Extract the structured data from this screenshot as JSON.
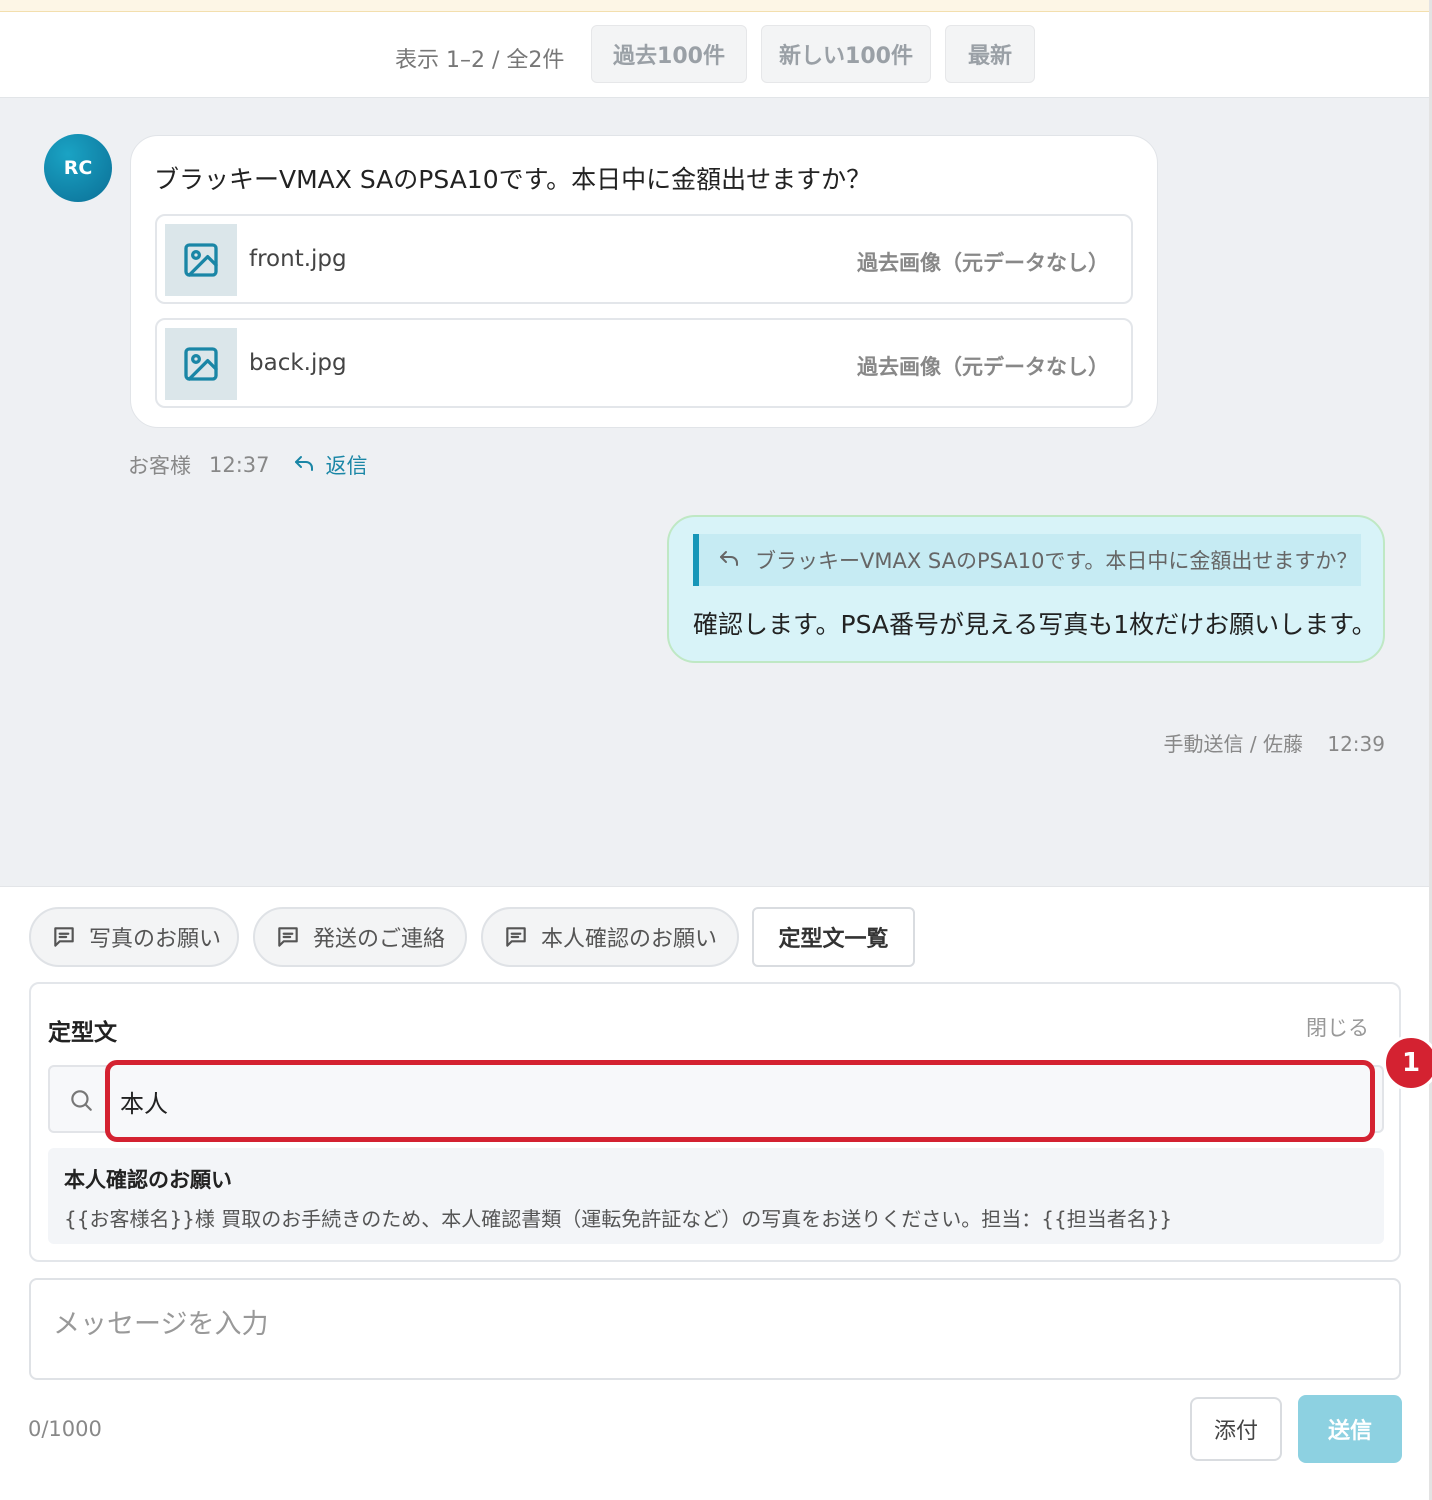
{
  "pager": {
    "info": "表示 1–2 / 全2件",
    "prev_label": "過去100件",
    "next_label": "新しい100件",
    "latest_label": "最新"
  },
  "messages": {
    "incoming": {
      "avatar_initials": "RC",
      "text": "ブラッキーVMAX SAのPSA10です。本日中に金額出せますか？",
      "attachments": [
        {
          "name": "front.jpg",
          "note": "過去画像（元データなし）",
          "icon": "image-icon"
        },
        {
          "name": "back.jpg",
          "note": "過去画像（元データなし）",
          "icon": "image-icon"
        }
      ],
      "sender": "お客様",
      "time": "12:37",
      "reply_label": "返信"
    },
    "outgoing": {
      "quote": "ブラッキーVMAX SAのPSA10です。本日中に金額出せますか？",
      "text": "確認します。PSA番号が見える写真も1枚だけお願いします。",
      "sender": "手動送信 / 佐藤",
      "time": "12:39"
    }
  },
  "composer": {
    "chips": [
      {
        "label": "写真のお願い",
        "icon": "message-icon"
      },
      {
        "label": "発送のご連絡",
        "icon": "message-icon"
      },
      {
        "label": "本人確認のお願い",
        "icon": "message-icon"
      }
    ],
    "template_list_label": "定型文一覧",
    "template_panel": {
      "title": "定型文",
      "close_label": "閉じる",
      "search_value": "本人",
      "badge": "1",
      "results": [
        {
          "title": "本人確認のお願い",
          "body": "{{お客様名}}様 買取のお手続きのため、本人確認書類（運転免許証など）の写真をお送りください。担当：{{担当者名}}"
        }
      ]
    },
    "message_placeholder": "メッセージを入力",
    "counter": "0/1000",
    "attach_label": "添付",
    "send_label": "送信"
  },
  "colors": {
    "accent": "#1a86a6",
    "highlight_red": "#d42231",
    "outgoing_bubble": "#d8f3f8",
    "send_button": "#8dd1e1"
  }
}
